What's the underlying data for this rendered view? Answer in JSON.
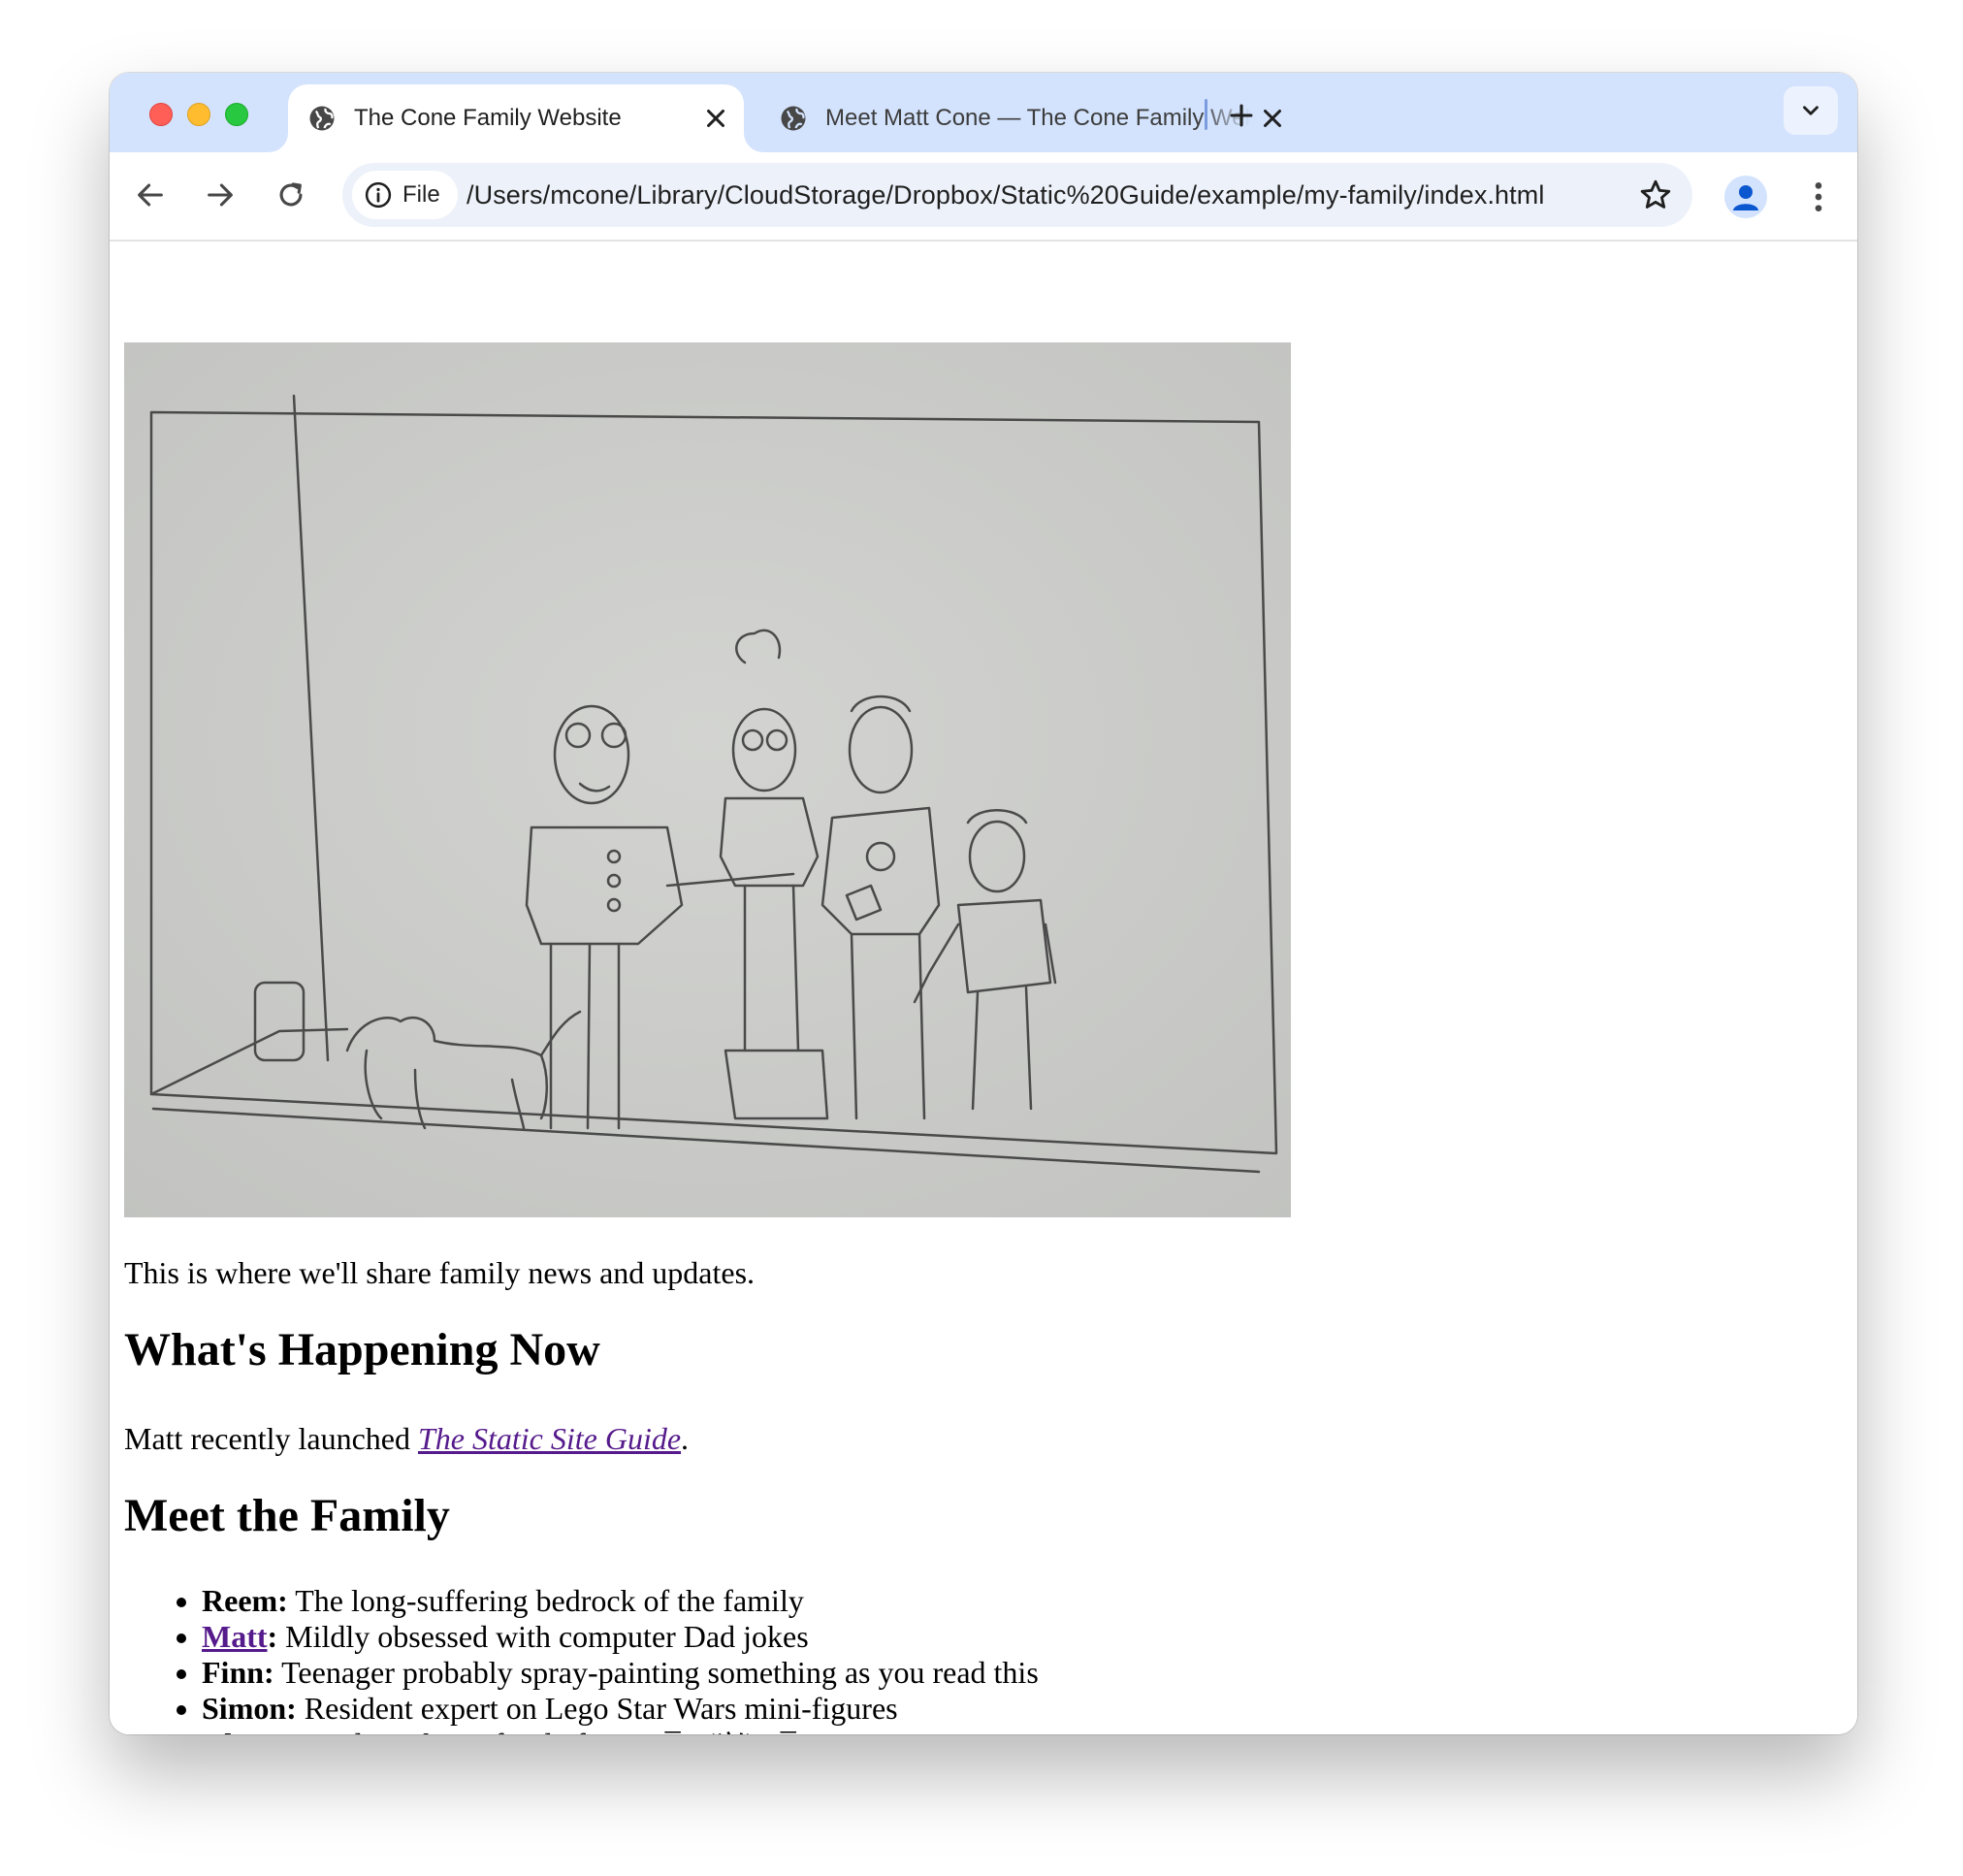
{
  "browser": {
    "tabs": [
      {
        "title": "The Cone Family Website",
        "active": true
      },
      {
        "title": "Meet Matt Cone — The Cone Family Website",
        "active": false
      }
    ],
    "address": {
      "scheme_chip": "File",
      "url": "/Users/mcone/Library/CloudStorage/Dropbox/Static%20Guide/example/my-family/index.html"
    },
    "colors": {
      "tabstrip": "#d3e3fd",
      "omnibox": "#edf2fa",
      "visited_link": "#551a8b"
    }
  },
  "page": {
    "intro": "This is where we'll share family news and updates.",
    "happening": {
      "heading": "What's Happening Now",
      "text_before": "Matt recently launched ",
      "link_text": "The Static Site Guide",
      "text_after": "."
    },
    "family": {
      "heading": "Meet the Family",
      "members": [
        {
          "name": "Reem",
          "name_is_link": false,
          "desc": "The long-suffering bedrock of the family"
        },
        {
          "name": "Matt",
          "name_is_link": true,
          "desc": "Mildly obsessed with computer Dad jokes"
        },
        {
          "name": "Finn",
          "name_is_link": false,
          "desc": "Teenager probably spray-painting something as you read this"
        },
        {
          "name": "Simon",
          "name_is_link": false,
          "desc": "Resident expert on Lego Star Wars mini-figures"
        },
        {
          "name": "Cleo",
          "name_is_link": false,
          "desc": "Cow dog who's afraid of cows ¯\\_(ツ)_/¯"
        }
      ]
    }
  }
}
